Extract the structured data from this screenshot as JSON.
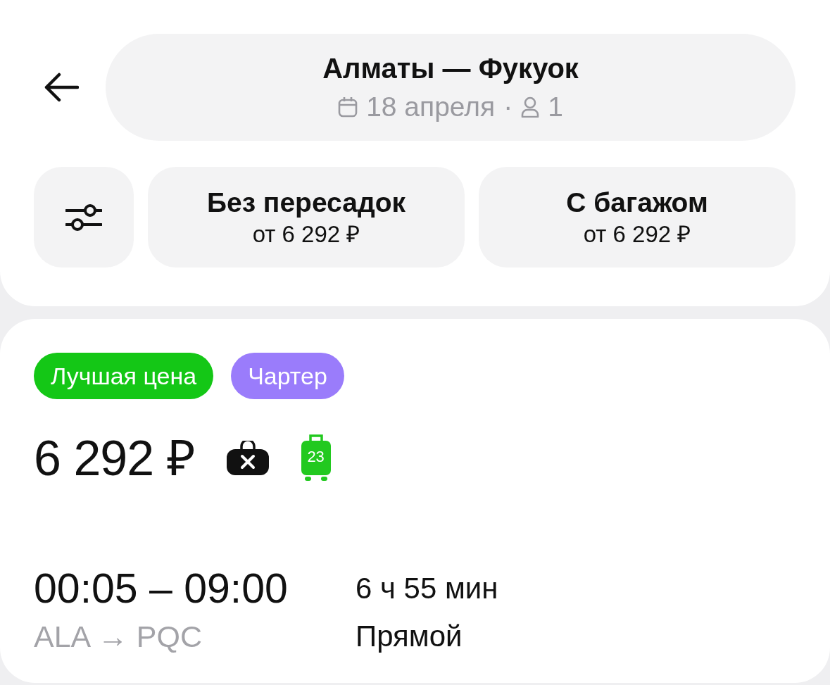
{
  "header": {
    "title": "Алматы — Фукуок",
    "date": "18 апреля",
    "separator": "·",
    "passengers": "1"
  },
  "filters": [
    {
      "title": "Без пересадок",
      "price": "от 6 292 ₽"
    },
    {
      "title": "С багажом",
      "price": "от 6 292 ₽"
    }
  ],
  "flight": {
    "badges": [
      {
        "label": "Лучшая цена",
        "color": "#14c716"
      },
      {
        "label": "Чартер",
        "color": "#9a7cfb"
      }
    ],
    "price": "6 292 ₽",
    "baggage": [
      {
        "kind": "crossed"
      },
      {
        "kind": "weight",
        "weight": "23"
      }
    ],
    "times": "00:05 – 09:00",
    "route": "ALA → PQC",
    "duration": "6 ч 55 мин",
    "stops": "Прямой"
  }
}
